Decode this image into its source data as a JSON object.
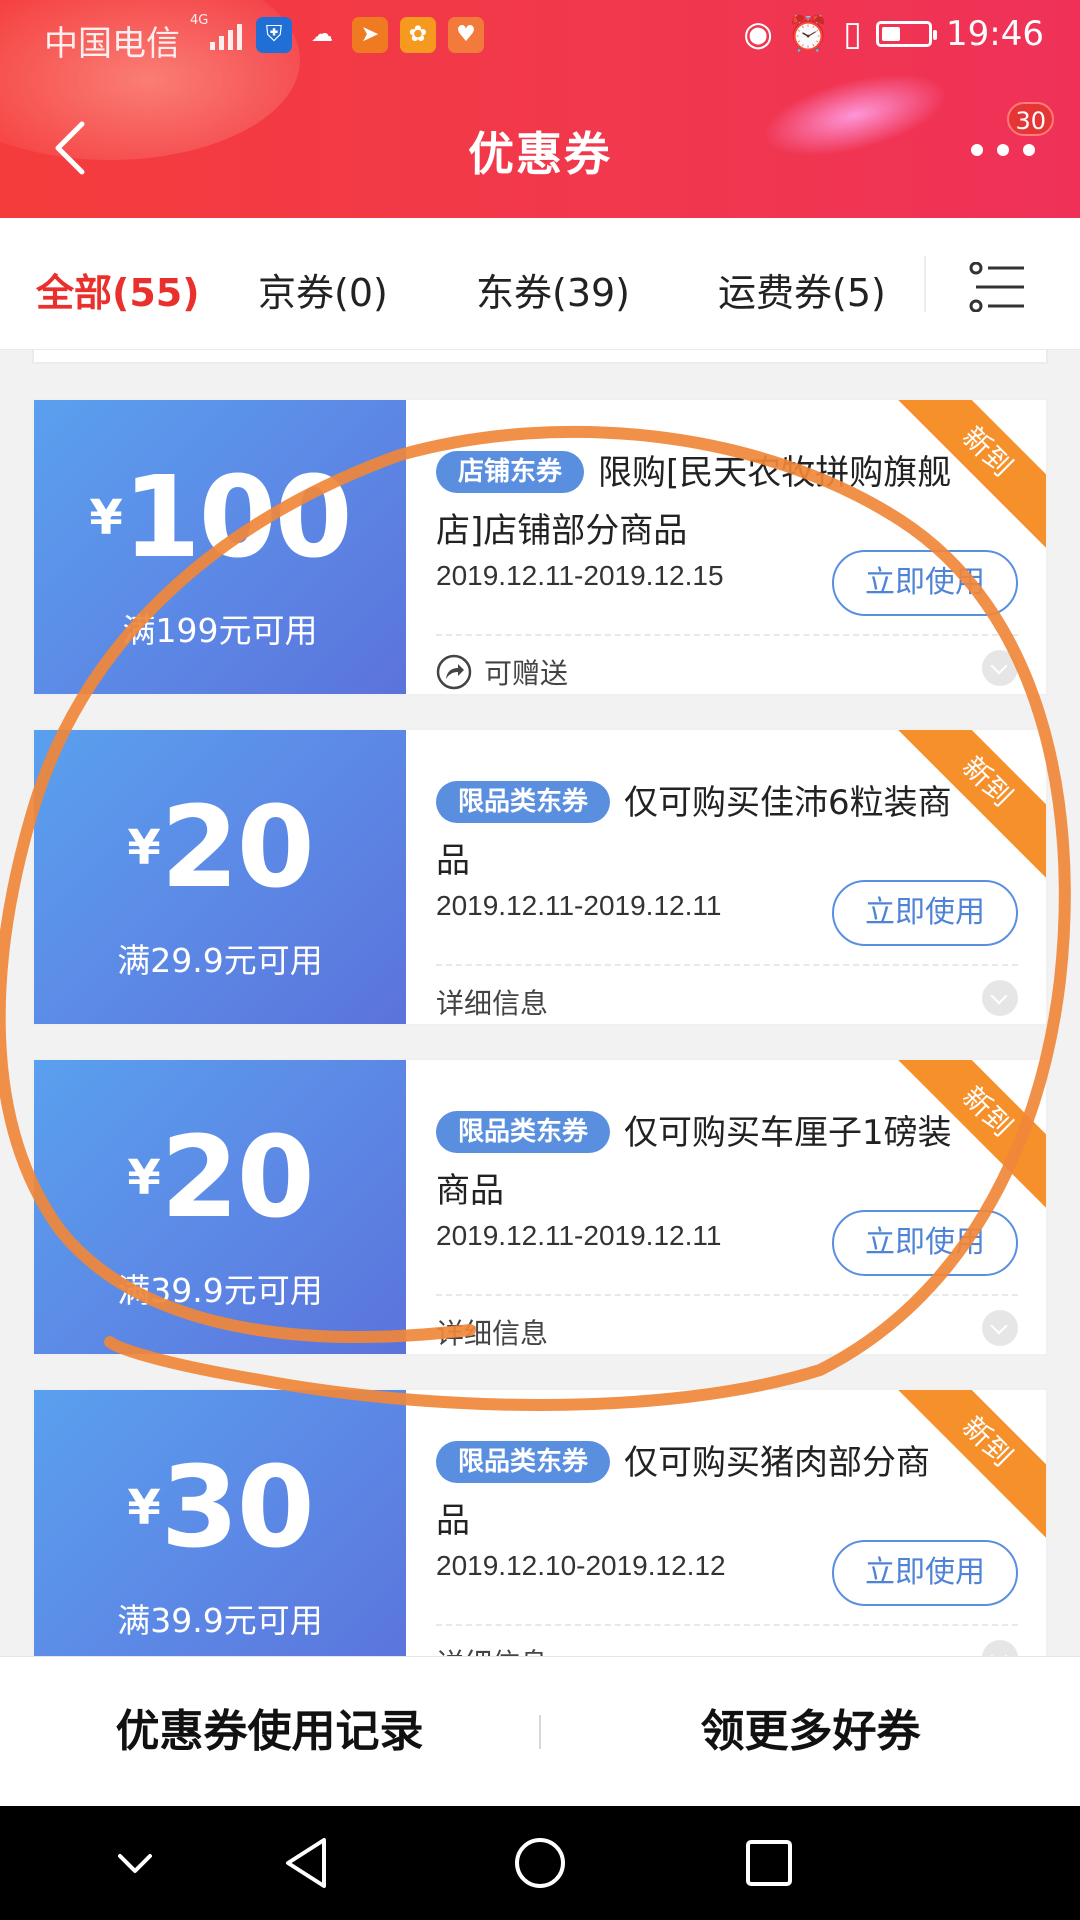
{
  "status": {
    "carrier": "中国电信",
    "network": "4G",
    "time": "19:46"
  },
  "header": {
    "title": "优惠券",
    "badge": "30"
  },
  "tabs": [
    {
      "label": "全部(55)",
      "active": true
    },
    {
      "label": "京券(0)",
      "active": false
    },
    {
      "label": "东券(39)",
      "active": false
    },
    {
      "label": "运费券(5)",
      "active": false
    }
  ],
  "coupons": [
    {
      "currency": "¥",
      "amount": "100",
      "condition": "满199元可用",
      "tag": "店铺东券",
      "description": "限购[民天农牧拼购旗舰店]店铺部分商品",
      "date": "2019.12.11-2019.12.15",
      "button": "立即使用",
      "footer": "可赠送",
      "ribbon": "新到"
    },
    {
      "currency": "¥",
      "amount": "20",
      "condition": "满29.9元可用",
      "tag": "限品类东券",
      "description": "仅可购买佳沛6粒装商品",
      "date": "2019.12.11-2019.12.11",
      "button": "立即使用",
      "footer": "详细信息",
      "ribbon": "新到"
    },
    {
      "currency": "¥",
      "amount": "20",
      "condition": "满39.9元可用",
      "tag": "限品类东券",
      "description": "仅可购买车厘子1磅装商品",
      "date": "2019.12.11-2019.12.11",
      "button": "立即使用",
      "footer": "详细信息",
      "ribbon": "新到"
    },
    {
      "currency": "¥",
      "amount": "30",
      "condition": "满39.9元可用",
      "tag": "限品类东券",
      "description": "仅可购买猪肉部分商品",
      "date": "2019.12.10-2019.12.12",
      "button": "立即使用",
      "footer": "详细信息",
      "ribbon": "新到"
    }
  ],
  "bottom": {
    "left": "优惠券使用记录",
    "right": "领更多好券"
  },
  "colors": {
    "header_red": "#f1384c",
    "active_tab": "#e9302c",
    "coupon_blue": "#5c8ae6",
    "ribbon_orange": "#f5902a",
    "annotation_orange": "#f0873a"
  }
}
